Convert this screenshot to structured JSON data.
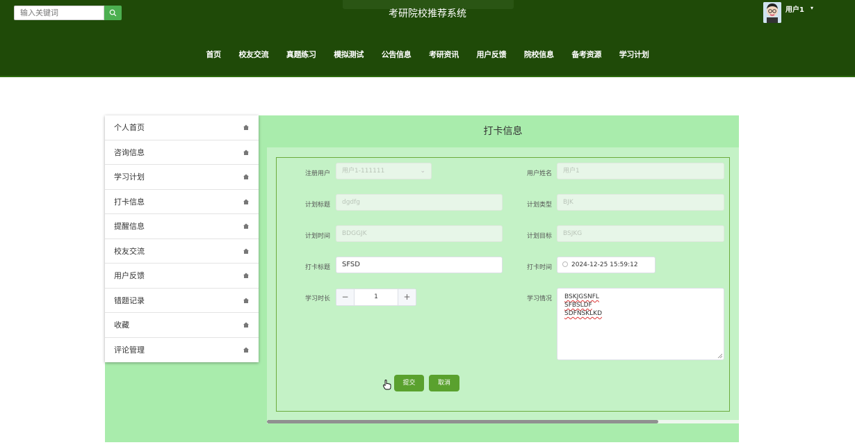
{
  "header": {
    "search_placeholder": "输入关键词",
    "title": "考研院校推荐系统",
    "user_name": "用户1",
    "caret": "▾"
  },
  "nav": {
    "items": [
      "首页",
      "校友交流",
      "真题练习",
      "模拟测试",
      "公告信息",
      "考研资讯",
      "用户反馈",
      "院校信息",
      "备考资源",
      "学习计划"
    ]
  },
  "sidebar": {
    "items": [
      "个人首页",
      "咨询信息",
      "学习计划",
      "打卡信息",
      "提醒信息",
      "校友交流",
      "用户反馈",
      "错题记录",
      "收藏",
      "评论管理"
    ]
  },
  "content": {
    "title": "打卡信息"
  },
  "form": {
    "reg_user_label": "注册用户",
    "reg_user_value": "用户1-111111",
    "user_name_label": "用户姓名",
    "user_name_value": "用户1",
    "plan_title_label": "计划标题",
    "plan_title_value": "dgdfg",
    "plan_type_label": "计划类型",
    "plan_type_value": "BJK",
    "plan_time_label": "计划时间",
    "plan_time_value": "BDGGJK",
    "plan_goal_label": "计划目标",
    "plan_goal_value": "BSJKG",
    "checkin_title_label": "打卡标题",
    "checkin_title_value": "SFSD",
    "checkin_time_label": "打卡时间",
    "checkin_time_value": "2024-12-25 15:59:12",
    "study_duration_label": "学习时长",
    "study_duration_value": "1",
    "study_status_label": "学习情况",
    "study_status_lines": [
      "BSKJGSNFL",
      "SFBSLDF",
      "SDFNSKLKD"
    ],
    "submit_label": "提交",
    "cancel_label": "取消"
  },
  "colors": {
    "header_bg": "#1f4a08",
    "page_bg": "#a9ecac",
    "panel_bg": "#c4f2c6",
    "button": "#5aa12e"
  }
}
